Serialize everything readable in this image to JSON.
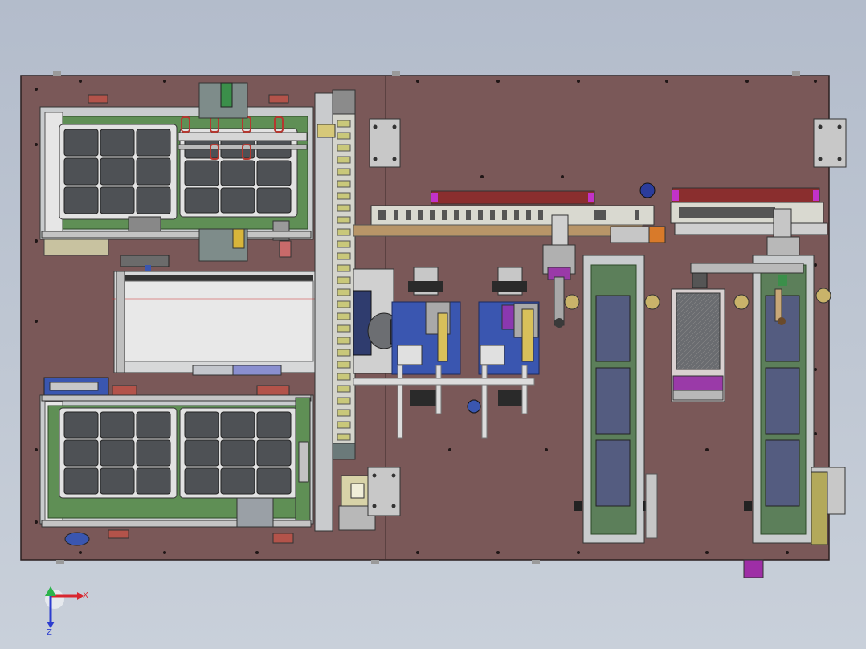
{
  "view": {
    "triad": {
      "x_label": "X",
      "z_label": "Z"
    }
  },
  "colors": {
    "background": "#bfc7d3",
    "base_plate": "#7a5858",
    "tray_green": "#5f8f55",
    "chip_gray": "#4e5155",
    "conveyor_belt": "#5c7f5a",
    "magenta_part": "#c232c8",
    "blue_part": "#3a56b0",
    "frame_gray": "#c9ccce",
    "axis_x": "#d8262f",
    "axis_y": "#2bb34a",
    "axis_z": "#2c3ccf"
  },
  "layout_summary": {
    "tray_units": 2,
    "tray_grid": "3x3",
    "conveyors": 2,
    "pick_heads": 2
  }
}
